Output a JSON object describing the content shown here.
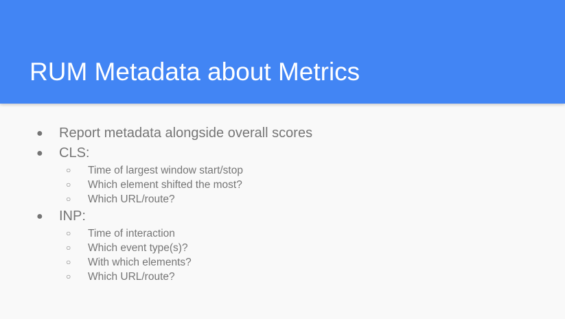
{
  "slide": {
    "title": "RUM Metadata about Metrics",
    "colors": {
      "header_bg": "#4285f4",
      "body_bg": "#f9f9f9",
      "title_text": "#ffffff",
      "body_text": "#757575"
    },
    "bullets": [
      {
        "text": "Report metadata alongside overall scores",
        "sub": []
      },
      {
        "text": "CLS:",
        "sub": [
          "Time of largest window start/stop",
          "Which element shifted the most?",
          "Which URL/route?"
        ]
      },
      {
        "text": "INP:",
        "sub": [
          "Time of interaction",
          "Which event type(s)?",
          "With which elements?",
          "Which URL/route?"
        ]
      }
    ]
  }
}
